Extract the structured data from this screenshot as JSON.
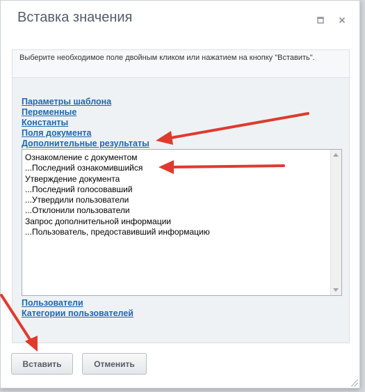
{
  "dialog": {
    "title": "Вставка значения",
    "hint": "Выберите необходимое поле двойным кликом или нажатием на кнопку \"Вставить\"."
  },
  "links_top": [
    "Параметры шаблона",
    "Переменные",
    "Константы",
    "Поля документа",
    "Дополнительные результаты"
  ],
  "list_options": [
    "Ознакомление с документом",
    "...Последний ознакомившийся",
    "Утверждение документа",
    "...Последний голосовавший",
    "...Утвердили пользователи",
    "...Отклонили пользователи",
    "Запрос дополнительной информации",
    "...Пользователь, предоставивший информацию"
  ],
  "links_bottom": [
    "Пользователи",
    "Категории пользователей"
  ],
  "buttons": {
    "insert": "Вставить",
    "cancel": "Отменить"
  },
  "colors": {
    "link": "#2067b0",
    "annotation_arrow": "#e03a2f",
    "title_text": "#535c69"
  },
  "icons": {
    "maximize": "maximize-icon",
    "close": "close-icon"
  }
}
